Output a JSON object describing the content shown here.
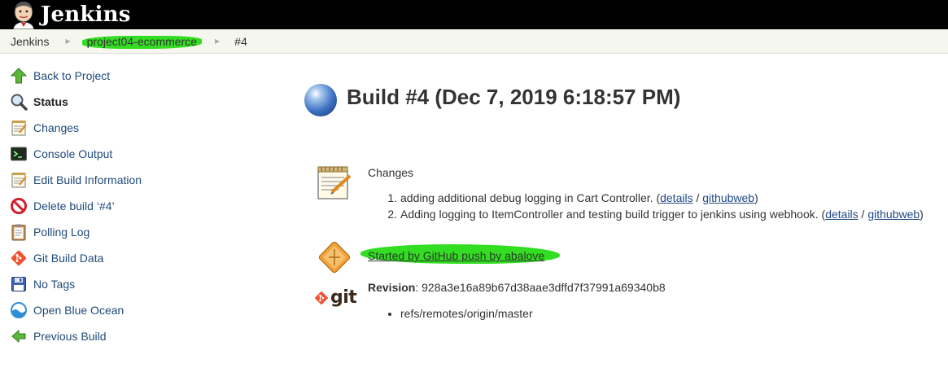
{
  "header": {
    "logo_text": "Jenkins",
    "background": "#000000"
  },
  "breadcrumb": {
    "items": [
      "Jenkins",
      "project04-ecommerce",
      "#4"
    ],
    "highlight_color": "#33dd22"
  },
  "sidebar": {
    "items": [
      {
        "label": "Back to Project",
        "icon": "up-arrow-icon"
      },
      {
        "label": "Status",
        "icon": "magnifier-icon"
      },
      {
        "label": "Changes",
        "icon": "notepad-icon"
      },
      {
        "label": "Console Output",
        "icon": "terminal-icon"
      },
      {
        "label": "Edit Build Information",
        "icon": "notepad-edit-icon"
      },
      {
        "label": "Delete build ‘#4’",
        "icon": "no-entry-icon"
      },
      {
        "label": "Polling Log",
        "icon": "clipboard-icon"
      },
      {
        "label": "Git Build Data",
        "icon": "git-diamond-icon"
      },
      {
        "label": "No Tags",
        "icon": "save-icon"
      },
      {
        "label": "Open Blue Ocean",
        "icon": "blue-ocean-icon"
      },
      {
        "label": "Previous Build",
        "icon": "left-arrow-icon"
      }
    ]
  },
  "main": {
    "title": "Build #4 (Dec 7, 2019 6:18:57 PM)",
    "status_color": "#3f74c4",
    "changes": {
      "label": "Changes",
      "items": [
        {
          "text": "adding additional debug logging in Cart Controller. (",
          "details": "details",
          "sep": " / ",
          "githubweb": "githubweb",
          "close": ")"
        },
        {
          "text": "Adding logging to ItemController and testing build trigger to jenkins using webhook. (",
          "details": "details",
          "sep": " / ",
          "githubweb": "githubweb",
          "close": ")"
        }
      ]
    },
    "started_by": "Started by GitHub push by abalove",
    "git": {
      "logo_text": "git",
      "revision_label": "Revision",
      "revision_value": ": 928a3e16a89b67d38aae3dffd7f37991a69340b8",
      "refs": [
        "refs/remotes/origin/master"
      ]
    }
  }
}
